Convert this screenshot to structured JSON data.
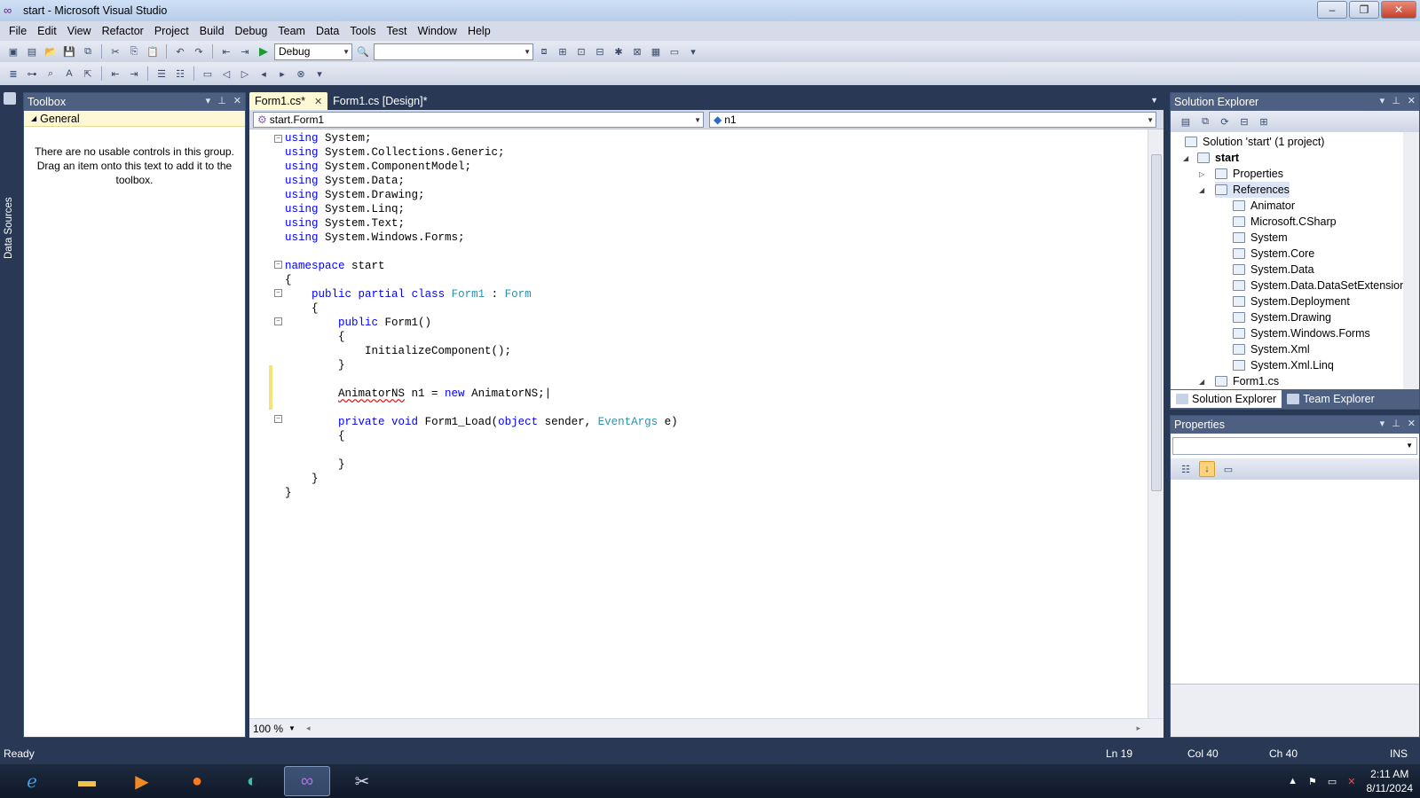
{
  "window": {
    "title": "start - Microsoft Visual Studio"
  },
  "menu": [
    "File",
    "Edit",
    "View",
    "Refactor",
    "Project",
    "Build",
    "Debug",
    "Team",
    "Data",
    "Tools",
    "Test",
    "Window",
    "Help"
  ],
  "toolbar": {
    "config": "Debug",
    "platform": ""
  },
  "left_strip": {
    "label": "Data Sources"
  },
  "toolbox": {
    "title": "Toolbox",
    "group": "General",
    "message": "There are no usable controls in this group. Drag an item onto this text to add it to the toolbox."
  },
  "editor": {
    "tabs": [
      {
        "label": "Form1.cs*"
      },
      {
        "label": "Form1.cs [Design]*"
      }
    ],
    "nav_class": "start.Form1",
    "nav_member": "n1",
    "zoom": "100 %"
  },
  "solution_explorer": {
    "title": "Solution Explorer",
    "items": {
      "solution": "Solution 'start' (1 project)",
      "project": "start",
      "properties": "Properties",
      "references": "References",
      "refs": [
        "Animator",
        "Microsoft.CSharp",
        "System",
        "System.Core",
        "System.Data",
        "System.Data.DataSetExtensions",
        "System.Deployment",
        "System.Drawing",
        "System.Windows.Forms",
        "System.Xml",
        "System.Xml.Linq"
      ],
      "form": "Form1.cs"
    },
    "tabs": [
      "Solution Explorer",
      "Team Explorer"
    ]
  },
  "properties_panel": {
    "title": "Properties"
  },
  "status": {
    "ready": "Ready",
    "ln": "Ln 19",
    "col": "Col 40",
    "ch": "Ch 40",
    "ins": "INS"
  },
  "clock": {
    "time": "2:11 AM",
    "date": "8/11/2024"
  },
  "colors": {
    "accent": "#293955",
    "keyword": "#0000ff",
    "type": "#2b91af",
    "tab_active": "#fff9d3"
  }
}
